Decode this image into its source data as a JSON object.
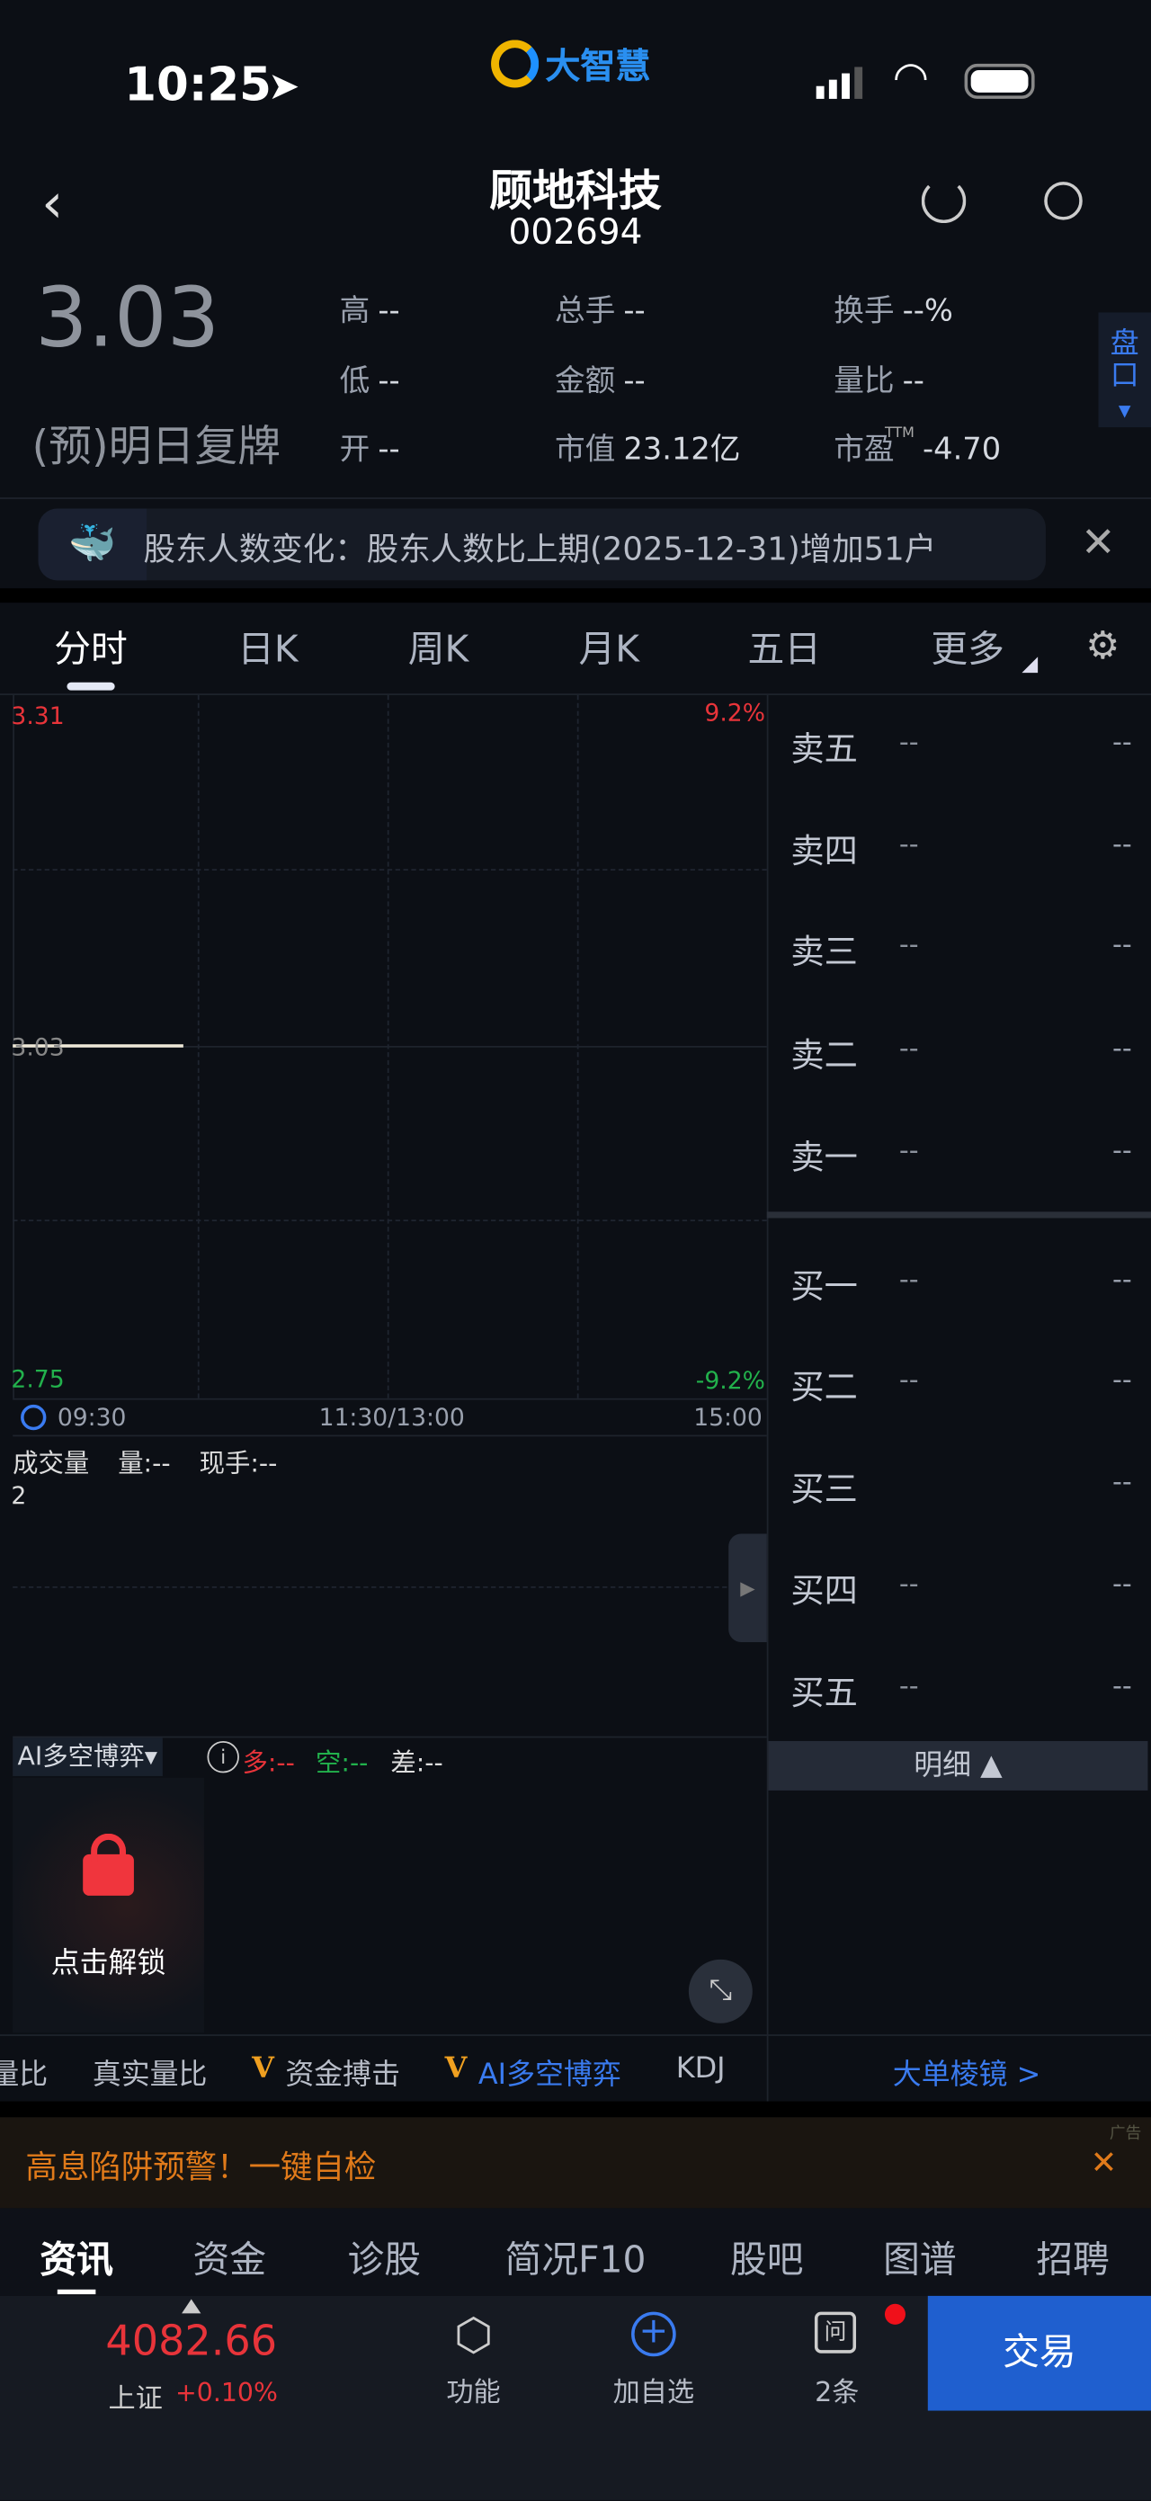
{
  "status": {
    "time": "10:25",
    "brand": "大智慧"
  },
  "header": {
    "name": "顾地科技",
    "code": "002694"
  },
  "quote": {
    "price": "3.03",
    "state": "(预)明日复牌",
    "stats": [
      {
        "label": "高",
        "value": "--"
      },
      {
        "label": "总手",
        "value": "--"
      },
      {
        "label": "换手",
        "value": "--%"
      },
      {
        "label": "低",
        "value": "--"
      },
      {
        "label": "金额",
        "value": "--"
      },
      {
        "label": "量比",
        "value": "--"
      },
      {
        "label": "开",
        "value": "--"
      },
      {
        "label": "市值",
        "value": "23.12亿"
      },
      {
        "label": "市盈",
        "value": "-4.70",
        "sup": "TTM"
      }
    ],
    "pankou": "盘口"
  },
  "notice": {
    "text": "股东人数变化：股东人数比上期(2025-12-31)增加51户"
  },
  "tabs": [
    "分时",
    "日K",
    "周K",
    "月K",
    "五日",
    "更多"
  ],
  "chart": {
    "top_price": "3.31",
    "top_pct": "9.2%",
    "mid_price": "3.03",
    "bottom_price": "2.75",
    "bottom_pct": "-9.2%",
    "times": [
      "09:30",
      "11:30/13:00",
      "15:00"
    ],
    "volume_title": "成交量",
    "volume_qty": "量:--",
    "volume_now": "现手:--",
    "volume_axis": "2"
  },
  "ai": {
    "title": "AI多空博弈▾",
    "long": "多:--",
    "short": "空:--",
    "diff": "差:--",
    "unlock": "点击解锁"
  },
  "orderbook": {
    "sell": [
      {
        "l": "卖五",
        "p": "--",
        "q": "--"
      },
      {
        "l": "卖四",
        "p": "--",
        "q": "--"
      },
      {
        "l": "卖三",
        "p": "--",
        "q": "--"
      },
      {
        "l": "卖二",
        "p": "--",
        "q": "--"
      },
      {
        "l": "卖一",
        "p": "--",
        "q": "--"
      }
    ],
    "buy": [
      {
        "l": "买一",
        "p": "--",
        "q": "--"
      },
      {
        "l": "买二",
        "p": "--",
        "q": "--"
      },
      {
        "l": "买三",
        "p": "",
        "q": "--"
      },
      {
        "l": "买四",
        "p": "--",
        "q": "--"
      },
      {
        "l": "买五",
        "p": "--",
        "q": "--"
      }
    ],
    "detail": "明细 ▲",
    "prism": "大单棱镜 >"
  },
  "indicators": [
    "量比",
    "真实量比",
    "资金搏击",
    "AI多空博弈",
    "KDJ"
  ],
  "ad": {
    "text": "高息陷阱预警！一键自检",
    "tag": "广告"
  },
  "bottom_tabs": [
    "资讯",
    "资金",
    "诊股",
    "简况F10",
    "股吧",
    "图谱",
    "招聘"
  ],
  "nav": {
    "index_value": "4082.66",
    "index_name": "上证",
    "index_change": "+0.10%",
    "func": "功能",
    "add": "加自选",
    "msgs": "2条",
    "trade": "交易"
  },
  "colors": {
    "up": "#e8343a",
    "down": "#22b14c",
    "accent": "#3a7bf0"
  }
}
